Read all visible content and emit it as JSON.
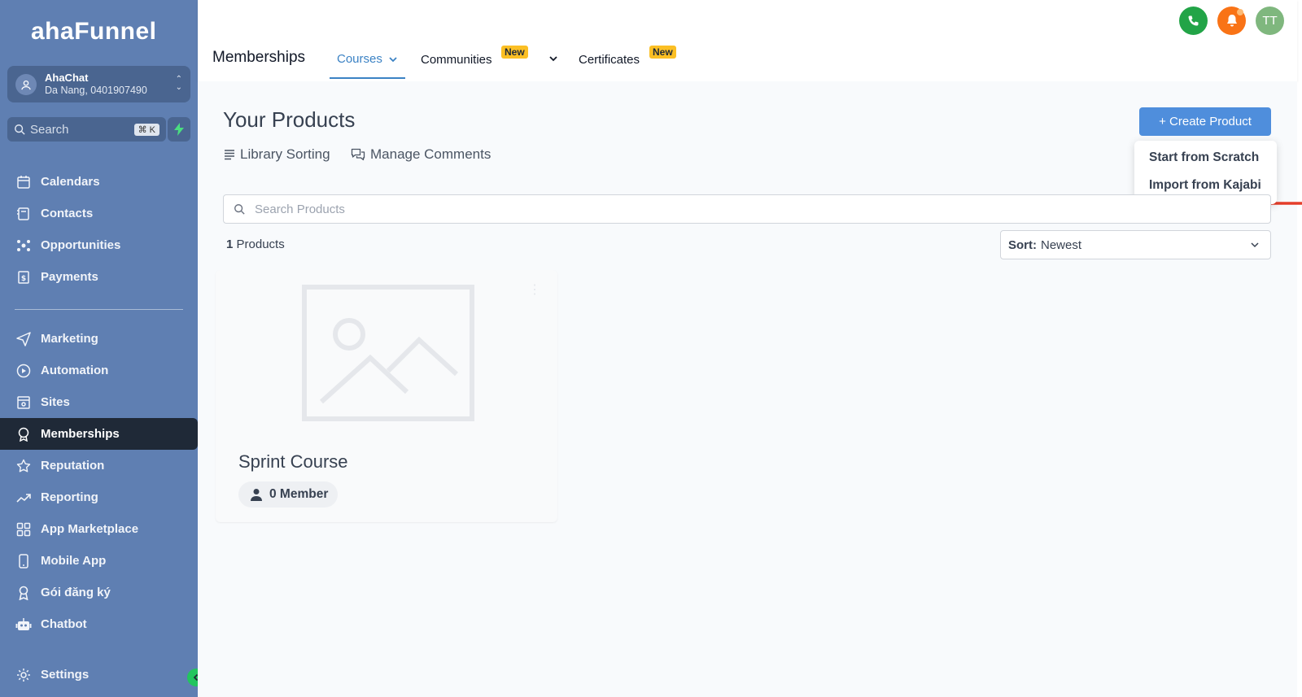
{
  "brand": {
    "logo": "ahaFunnel"
  },
  "account": {
    "name": "AhaChat",
    "location": "Da Nang, 0401907490"
  },
  "sidebar_search": {
    "placeholder": "Search",
    "shortcut": "⌘ K"
  },
  "nav": {
    "group1": [
      {
        "label": "Calendars",
        "icon": "calendar-icon"
      },
      {
        "label": "Contacts",
        "icon": "contacts-icon"
      },
      {
        "label": "Opportunities",
        "icon": "opportunities-icon"
      },
      {
        "label": "Payments",
        "icon": "payments-icon"
      }
    ],
    "group2": [
      {
        "label": "Marketing",
        "icon": "send-icon"
      },
      {
        "label": "Automation",
        "icon": "automation-icon"
      },
      {
        "label": "Sites",
        "icon": "sites-icon"
      },
      {
        "label": "Memberships",
        "icon": "badge-icon",
        "active": true
      },
      {
        "label": "Reputation",
        "icon": "star-icon"
      },
      {
        "label": "Reporting",
        "icon": "trend-icon"
      },
      {
        "label": "App Marketplace",
        "icon": "grid-icon"
      },
      {
        "label": "Mobile App",
        "icon": "mobile-icon"
      },
      {
        "label": "Gói đăng ký",
        "icon": "ribbon-icon"
      },
      {
        "label": "Chatbot",
        "icon": "robot-icon"
      }
    ],
    "settings": {
      "label": "Settings",
      "icon": "gear-icon"
    }
  },
  "header": {
    "title": "Memberships",
    "tabs": {
      "courses": "Courses",
      "communities": "Communities",
      "certificates": "Certificates",
      "new_badge": "New"
    },
    "avatar_initials": "TT"
  },
  "main": {
    "title": "Your Products",
    "library_sorting": "Library Sorting",
    "manage_comments": "Manage Comments",
    "create_button": "+ Create Product",
    "dropdown": {
      "scratch": "Start from Scratch",
      "kajabi": "Import from Kajabi"
    },
    "search_placeholder": "Search Products",
    "count_number": "1",
    "count_label": "Products",
    "sort_label": "Sort:",
    "sort_value": "Newest",
    "product": {
      "title": "Sprint Course",
      "members": "0 Member"
    }
  },
  "colors": {
    "sidebar": "#5f7fb2",
    "accent": "#4f8edc",
    "active_tab": "#3b82c4",
    "badge_new": "#fbbf24",
    "phone": "#22a447",
    "bell": "#f97316",
    "avatar": "#7fb77e",
    "arrow": "#e53e2a"
  }
}
